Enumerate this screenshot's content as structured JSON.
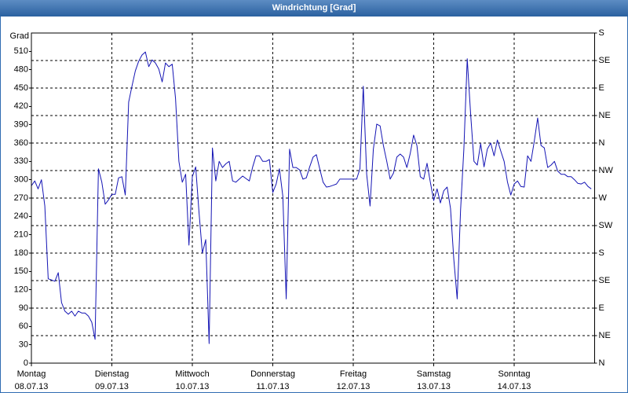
{
  "colors": {
    "title_bar": "#2f6cb2",
    "title_text": "#ffffff",
    "series_line": "#1414b4",
    "grid": "#000000"
  },
  "chart_data": {
    "type": "line",
    "title": "Windrichtung [Grad]",
    "xlabel": "",
    "ylabel": "Grad",
    "ylim": [
      0,
      540
    ],
    "xlim": [
      "08.07.13 00:00",
      "15.07.13 00:00"
    ],
    "grid": true,
    "legend": "none",
    "yticks": [
      0,
      30,
      60,
      90,
      120,
      150,
      180,
      210,
      240,
      270,
      300,
      330,
      360,
      390,
      420,
      450,
      480,
      510
    ],
    "y2ticks": [
      {
        "value": 0,
        "label": "N"
      },
      {
        "value": 45,
        "label": "NE"
      },
      {
        "value": 90,
        "label": "E"
      },
      {
        "value": 135,
        "label": "SE"
      },
      {
        "value": 180,
        "label": "S"
      },
      {
        "value": 225,
        "label": "SW"
      },
      {
        "value": 270,
        "label": "W"
      },
      {
        "value": 315,
        "label": "NW"
      },
      {
        "value": 360,
        "label": "N"
      },
      {
        "value": 405,
        "label": "NE"
      },
      {
        "value": 450,
        "label": "E"
      },
      {
        "value": 495,
        "label": "SE"
      },
      {
        "value": 540,
        "label": "S"
      }
    ],
    "xticks": [
      {
        "label": "Montag",
        "date": "08.07.13"
      },
      {
        "label": "Dienstag",
        "date": "09.07.13"
      },
      {
        "label": "Mittwoch",
        "date": "10.07.13"
      },
      {
        "label": "Donnerstag",
        "date": "11.07.13"
      },
      {
        "label": "Freitag",
        "date": "12.07.13"
      },
      {
        "label": "Samstag",
        "date": "13.07.13"
      },
      {
        "label": "Sonntag",
        "date": "14.07.13"
      }
    ],
    "series": [
      {
        "x": [
          "08.07.13 00:00",
          "08.07.13 01:00",
          "08.07.13 02:00",
          "08.07.13 03:00",
          "08.07.13 04:00",
          "08.07.13 05:00",
          "08.07.13 06:00",
          "08.07.13 07:00",
          "08.07.13 08:00",
          "08.07.13 09:00",
          "08.07.13 10:00",
          "08.07.13 11:00",
          "08.07.13 12:00",
          "08.07.13 13:00",
          "08.07.13 14:00",
          "08.07.13 15:00",
          "08.07.13 16:00",
          "08.07.13 17:00",
          "08.07.13 18:00",
          "08.07.13 19:00",
          "08.07.13 20:00",
          "08.07.13 21:00",
          "08.07.13 22:00",
          "08.07.13 23:00",
          "09.07.13 00:00",
          "09.07.13 01:00",
          "09.07.13 02:00",
          "09.07.13 03:00",
          "09.07.13 04:00",
          "09.07.13 05:00",
          "09.07.13 06:00",
          "09.07.13 07:00",
          "09.07.13 08:00",
          "09.07.13 09:00",
          "09.07.13 10:00",
          "09.07.13 11:00",
          "09.07.13 12:00",
          "09.07.13 13:00",
          "09.07.13 14:00",
          "09.07.13 15:00",
          "09.07.13 16:00",
          "09.07.13 17:00",
          "09.07.13 18:00",
          "09.07.13 19:00",
          "09.07.13 20:00",
          "09.07.13 21:00",
          "09.07.13 22:00",
          "09.07.13 23:00",
          "10.07.13 00:00",
          "10.07.13 01:00",
          "10.07.13 02:00",
          "10.07.13 03:00",
          "10.07.13 04:00",
          "10.07.13 05:00",
          "10.07.13 06:00",
          "10.07.13 07:00",
          "10.07.13 08:00",
          "10.07.13 09:00",
          "10.07.13 10:00",
          "10.07.13 11:00",
          "10.07.13 12:00",
          "10.07.13 13:00",
          "10.07.13 14:00",
          "10.07.13 15:00",
          "10.07.13 16:00",
          "10.07.13 17:00",
          "10.07.13 18:00",
          "10.07.13 19:00",
          "10.07.13 20:00",
          "10.07.13 21:00",
          "10.07.13 22:00",
          "10.07.13 23:00",
          "11.07.13 00:00",
          "11.07.13 01:00",
          "11.07.13 02:00",
          "11.07.13 03:00",
          "11.07.13 04:00",
          "11.07.13 05:00",
          "11.07.13 06:00",
          "11.07.13 07:00",
          "11.07.13 08:00",
          "11.07.13 09:00",
          "11.07.13 10:00",
          "11.07.13 11:00",
          "11.07.13 12:00",
          "11.07.13 13:00",
          "11.07.13 14:00",
          "11.07.13 15:00",
          "11.07.13 16:00",
          "11.07.13 17:00",
          "11.07.13 18:00",
          "11.07.13 19:00",
          "11.07.13 20:00",
          "11.07.13 21:00",
          "11.07.13 22:00",
          "11.07.13 23:00",
          "12.07.13 00:00",
          "12.07.13 01:00",
          "12.07.13 02:00",
          "12.07.13 03:00",
          "12.07.13 04:00",
          "12.07.13 05:00",
          "12.07.13 06:00",
          "12.07.13 07:00",
          "12.07.13 08:00",
          "12.07.13 09:00",
          "12.07.13 10:00",
          "12.07.13 11:00",
          "12.07.13 12:00",
          "12.07.13 13:00",
          "12.07.13 14:00",
          "12.07.13 15:00",
          "12.07.13 16:00",
          "12.07.13 17:00",
          "12.07.13 18:00",
          "12.07.13 19:00",
          "12.07.13 20:00",
          "12.07.13 21:00",
          "12.07.13 22:00",
          "12.07.13 23:00",
          "13.07.13 00:00",
          "13.07.13 01:00",
          "13.07.13 02:00",
          "13.07.13 03:00",
          "13.07.13 04:00",
          "13.07.13 05:00",
          "13.07.13 06:00",
          "13.07.13 07:00",
          "13.07.13 08:00",
          "13.07.13 09:00",
          "13.07.13 10:00",
          "13.07.13 11:00",
          "13.07.13 12:00",
          "13.07.13 13:00",
          "13.07.13 14:00",
          "13.07.13 15:00",
          "13.07.13 16:00",
          "13.07.13 17:00",
          "13.07.13 18:00",
          "13.07.13 19:00",
          "13.07.13 20:00",
          "13.07.13 21:00",
          "13.07.13 22:00",
          "13.07.13 23:00",
          "14.07.13 00:00",
          "14.07.13 01:00",
          "14.07.13 02:00",
          "14.07.13 03:00",
          "14.07.13 04:00",
          "14.07.13 05:00",
          "14.07.13 06:00",
          "14.07.13 07:00",
          "14.07.13 08:00",
          "14.07.13 09:00",
          "14.07.13 10:00",
          "14.07.13 11:00",
          "14.07.13 12:00",
          "14.07.13 13:00",
          "14.07.13 14:00",
          "14.07.13 15:00",
          "14.07.13 16:00",
          "14.07.13 17:00",
          "14.07.13 18:00",
          "14.07.13 19:00",
          "14.07.13 20:00",
          "14.07.13 21:00",
          "14.07.13 22:00",
          "14.07.13 23:00"
        ],
        "y": [
          290,
          298,
          285,
          300,
          257,
          138,
          136,
          134,
          148,
          99,
          85,
          80,
          85,
          77,
          85,
          82,
          82,
          77,
          67,
          39,
          318,
          296,
          260,
          267,
          276,
          276,
          303,
          305,
          275,
          427,
          453,
          478,
          494,
          504,
          509,
          485,
          496,
          491,
          481,
          460,
          491,
          485,
          489,
          433,
          330,
          296,
          309,
          193,
          305,
          321,
          247,
          180,
          202,
          32,
          352,
          298,
          330,
          320,
          326,
          330,
          298,
          296,
          301,
          306,
          302,
          298,
          321,
          339,
          339,
          330,
          330,
          333,
          279,
          293,
          318,
          273,
          105,
          350,
          320,
          320,
          316,
          301,
          303,
          321,
          337,
          341,
          318,
          296,
          288,
          289,
          291,
          293,
          301,
          301,
          301,
          301,
          301,
          301,
          318,
          453,
          309,
          257,
          350,
          391,
          388,
          356,
          330,
          301,
          311,
          337,
          342,
          337,
          320,
          343,
          373,
          356,
          305,
          301,
          327,
          296,
          266,
          285,
          262,
          282,
          288,
          253,
          170,
          105,
          250,
          350,
          498,
          408,
          330,
          324,
          359,
          321,
          350,
          360,
          339,
          365,
          347,
          330,
          296,
          275,
          293,
          298,
          289,
          288,
          339,
          330,
          363,
          401,
          356,
          352,
          320,
          324,
          330,
          314,
          309,
          309,
          305,
          305,
          300,
          294,
          293,
          296,
          289,
          285
        ]
      }
    ]
  }
}
